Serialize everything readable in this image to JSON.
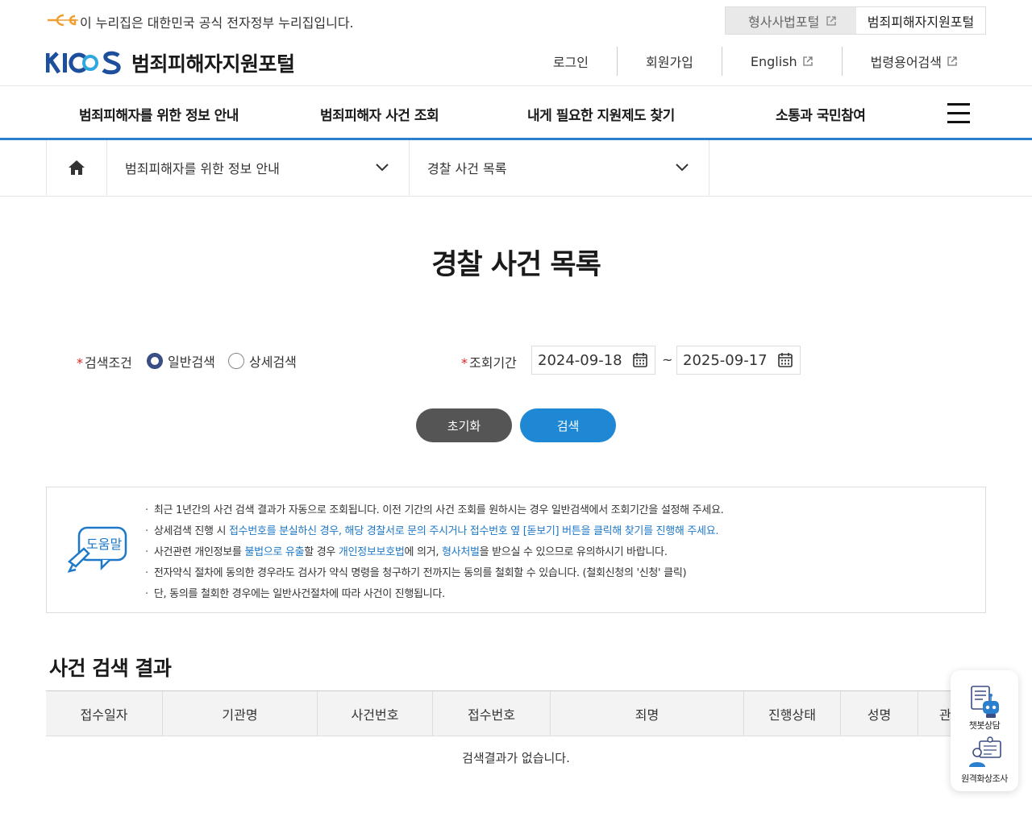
{
  "gov_banner": {
    "text": "이 누리집은 대한민국 공식 전자정부 누리집입니다.",
    "logo_icon": "egov-logo-icon"
  },
  "portal_links": [
    {
      "label": "형사사법포털",
      "icon": "external-link-icon"
    },
    {
      "label": "범죄피해자지원포털"
    }
  ],
  "brand": {
    "logo_text": "KICS",
    "name": "범죄피해자지원포털"
  },
  "util_menu": [
    {
      "label": "로그인"
    },
    {
      "label": "회원가입"
    },
    {
      "label": "English",
      "icon": "external-link-icon"
    },
    {
      "label": "법령용어검색",
      "icon": "external-link-icon"
    }
  ],
  "gnb": [
    {
      "label": "범죄피해자를 위한 정보 안내"
    },
    {
      "label": "범죄피해자 사건 조회"
    },
    {
      "label": "내게 필요한 지원제도 찾기"
    },
    {
      "label": "소통과 국민참여"
    }
  ],
  "location": {
    "level1": "범죄피해자를 위한 정보 안내",
    "level2": "경찰 사건 목록"
  },
  "page_title": "경찰 사건 목록",
  "search": {
    "condition_label": "검색조건",
    "radio_general": "일반검색",
    "radio_detail": "상세검색",
    "selected": "일반검색",
    "period_label": "조회기간",
    "date_from": "2024-09-18",
    "date_to": "2025-09-17",
    "tilde": "~",
    "reset_label": "초기화",
    "search_label": "검색"
  },
  "help": {
    "icon_label": "도움말",
    "lines": {
      "l1": "최근 1년간의 사건 검색 결과가 자동으로 조회됩니다. 이전 기간의 사건 조회를 원하시는 경우 일반검색에서 조회기간을 설정해 주세요.",
      "l2a": "상세검색 진행 시 ",
      "l2b": "접수번호를 분실하신 경우, 해당 경찰서로 문의 주시거나 접수번호 옆 [돋보기] 버튼을 클릭해 찾기를 진행해 주세요.",
      "l3a": "사건관련 개인정보를 ",
      "l3b": "불법으로 유출",
      "l3c": "할 경우 ",
      "l3d": "개인정보보호법",
      "l3e": "에 의거, ",
      "l3f": "형사처벌",
      "l3g": "을 받으실 수 있으므로 유의하시기 바랍니다.",
      "l4": "전자약식 절차에 동의한 경우라도 검사가 약식 명령을 청구하기 전까지는 동의를 철회할 수 있습니다. (철회신청의 '신청' 클릭)",
      "l5": "단, 동의를 철회한 경우에는 일반사건절차에 따라 사건이 진행됩니다."
    }
  },
  "results": {
    "title": "사건 검색 결과",
    "columns": [
      "접수일자",
      "기관명",
      "사건번호",
      "접수번호",
      "죄명",
      "진행상태",
      "성명",
      "관"
    ],
    "empty_text": "검색결과가 없습니다."
  },
  "quick_menu": [
    {
      "label": "챗봇상담",
      "icon": "chatbot-icon"
    },
    {
      "label": "원격화상조사",
      "icon": "video-call-icon"
    }
  ],
  "colors": {
    "accent_blue": "#1e88d5",
    "nav_border": "#2a7fce",
    "radio_selected": "#3b4d85",
    "required": "#dd2222"
  }
}
